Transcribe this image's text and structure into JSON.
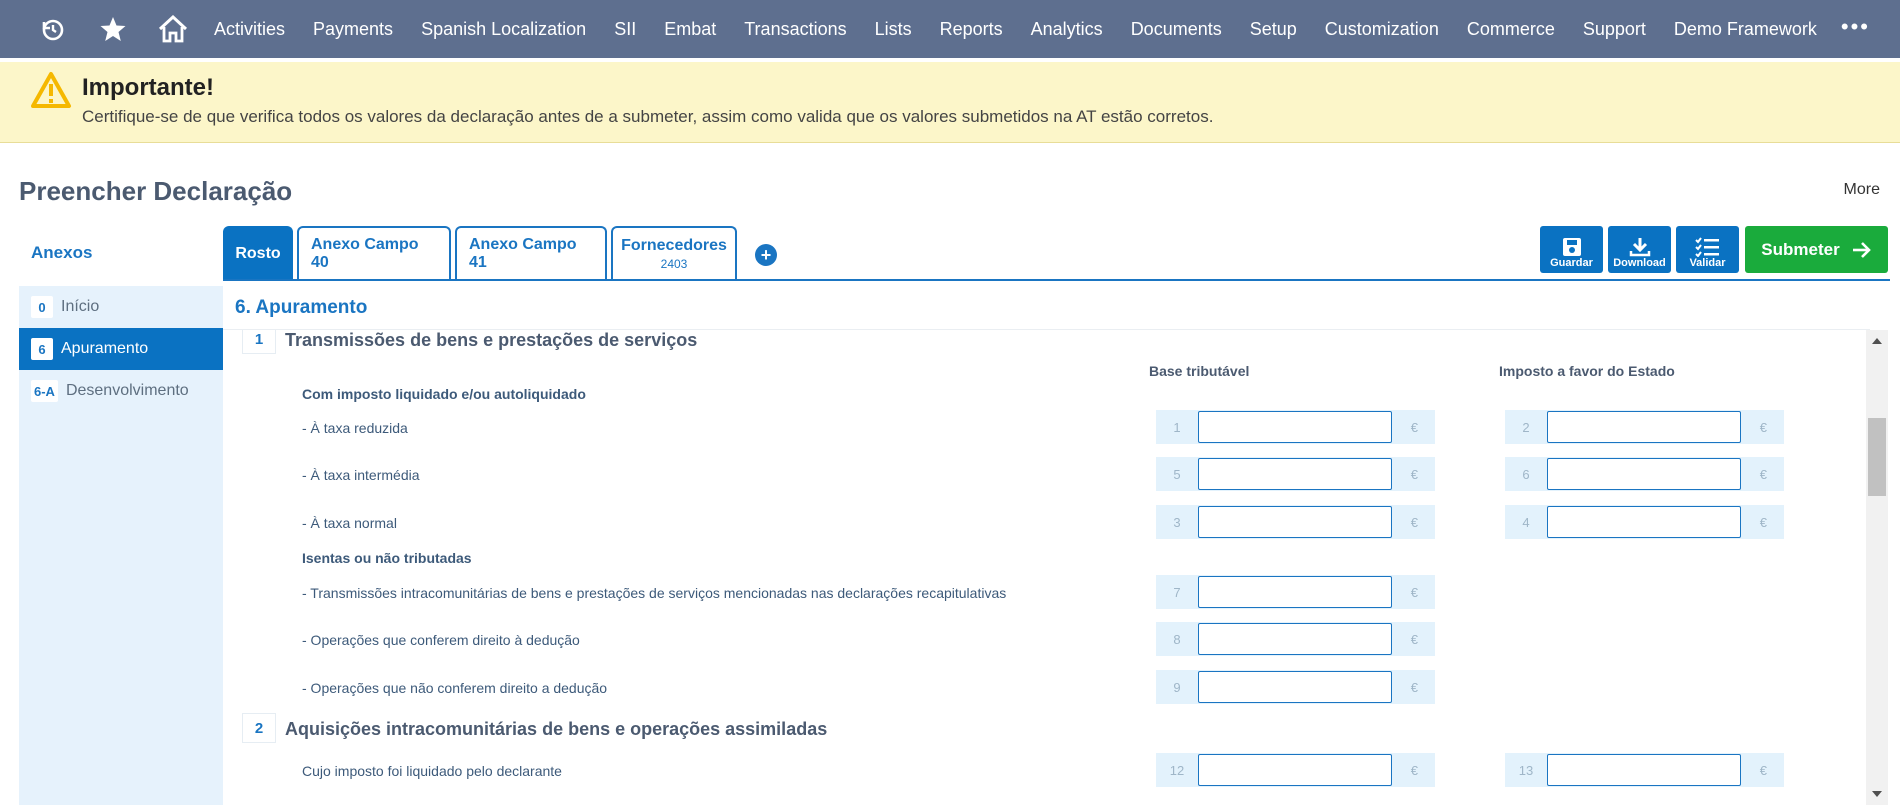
{
  "nav": {
    "items": [
      "Activities",
      "Payments",
      "Spanish Localization",
      "SII",
      "Embat",
      "Transactions",
      "Lists",
      "Reports",
      "Analytics",
      "Documents",
      "Setup",
      "Customization",
      "Commerce",
      "Support",
      "Demo Framework"
    ],
    "more": "•••",
    "icons": [
      "history-icon",
      "star-icon",
      "home-icon"
    ]
  },
  "alert": {
    "title": "Importante!",
    "message": "Certifique-se de que verifica todos os valores da declaração antes de a submeter, assim como valida que os valores submetidos na AT estão corretos."
  },
  "page": {
    "title": "Preencher Declaração",
    "more": "More"
  },
  "sidebar": {
    "heading": "Anexos",
    "items": [
      {
        "num": "0",
        "label": "Início"
      },
      {
        "num": "6",
        "label": "Apuramento"
      },
      {
        "num": "6-A",
        "label": "Desenvolvimento"
      }
    ]
  },
  "tabs": [
    {
      "label": "Rosto"
    },
    {
      "label": "Anexo Campo 40"
    },
    {
      "label": "Anexo Campo 41"
    },
    {
      "label": "Fornecedores",
      "sub": "2403"
    }
  ],
  "actions": {
    "save": "Guardar",
    "download": "Download",
    "validate": "Validar",
    "submit": "Submeter"
  },
  "section": {
    "title": "6. Apuramento",
    "col_base": "Base tributável",
    "col_tax": "Imposto a favor do Estado",
    "currency": "€",
    "q1": {
      "num": "1",
      "title": "Transmissões de bens e prestações de serviços",
      "sub1": "Com imposto liquidado e/ou autoliquidado",
      "sub2": "Isentas ou não tributadas",
      "rows": [
        {
          "label": "- À taxa reduzida",
          "base_num": "1",
          "tax_num": "2"
        },
        {
          "label": "- À taxa intermédia",
          "base_num": "5",
          "tax_num": "6"
        },
        {
          "label": "- À taxa normal",
          "base_num": "3",
          "tax_num": "4"
        },
        {
          "label": "- Transmissões intracomunitárias de bens e prestações de serviços mencionadas nas declarações recapitulativas",
          "base_num": "7"
        },
        {
          "label": "- Operações que conferem direito à dedução",
          "base_num": "8"
        },
        {
          "label": "- Operações que não conferem direito a dedução",
          "base_num": "9"
        }
      ]
    },
    "q2": {
      "num": "2",
      "title": "Aquisições intracomunitárias de bens e operações assimiladas",
      "rows": [
        {
          "label": "Cujo imposto foi liquidado pelo declarante",
          "base_num": "12",
          "tax_num": "13"
        }
      ]
    }
  }
}
